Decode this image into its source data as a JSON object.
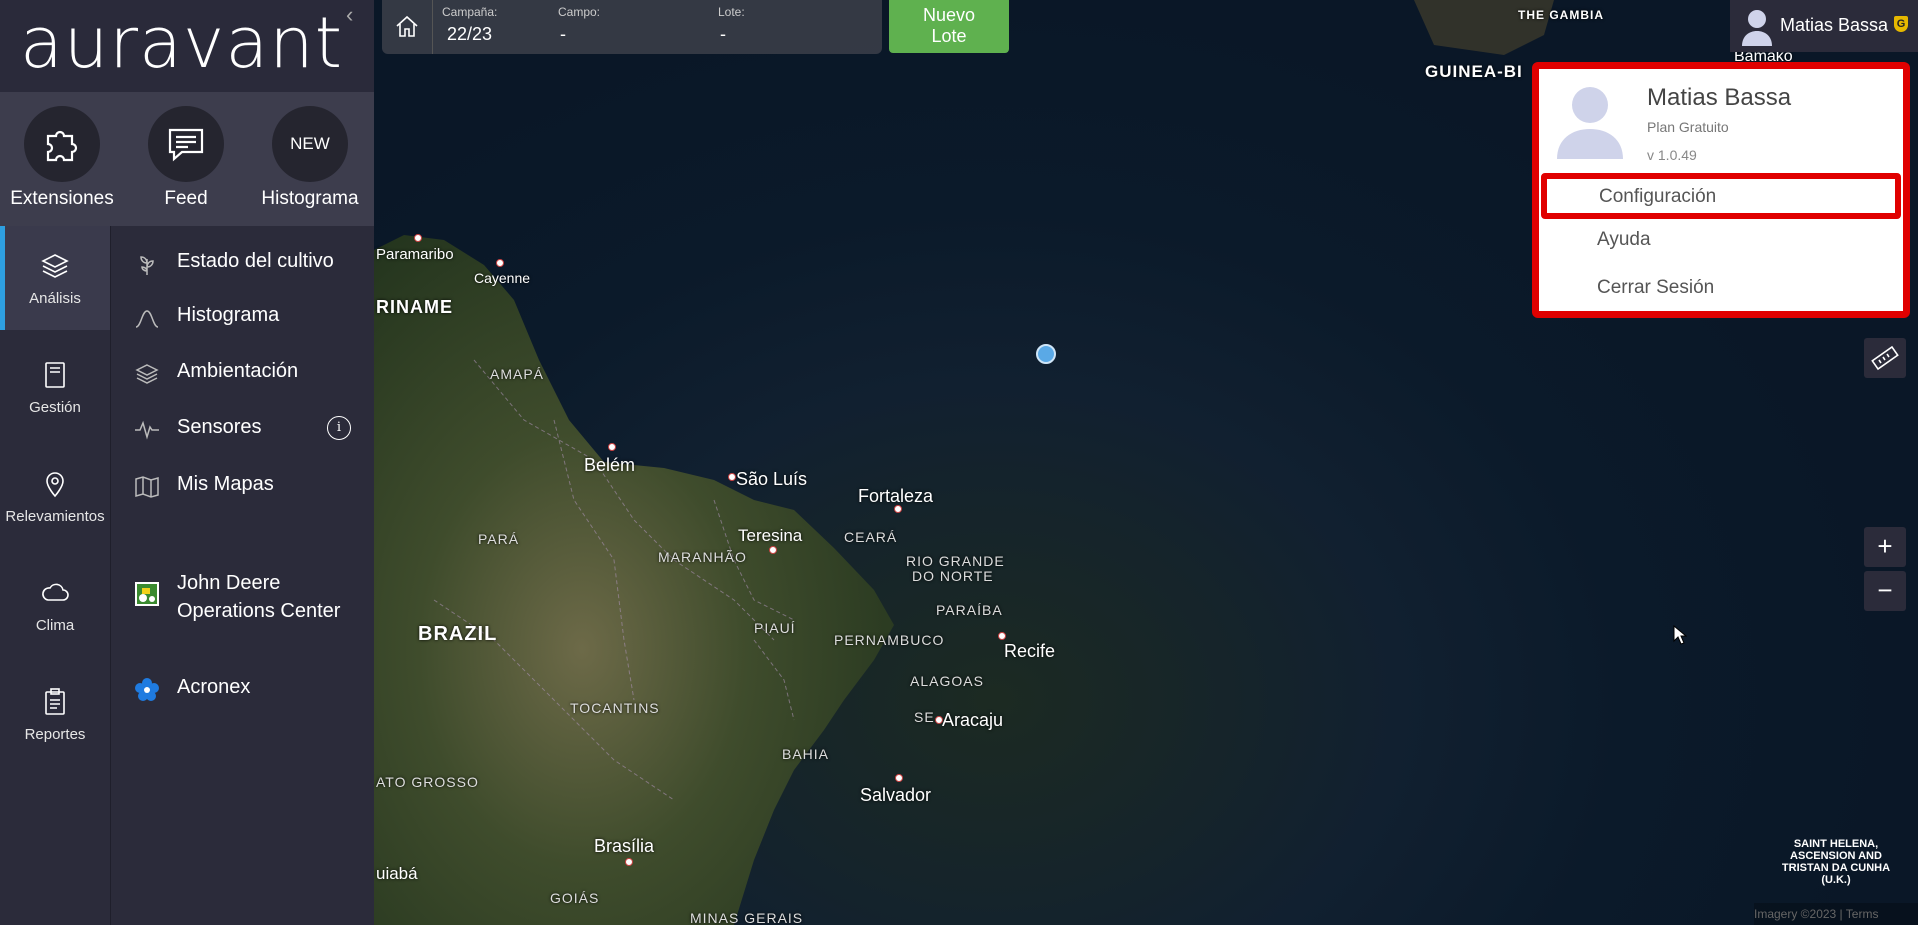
{
  "brand": {
    "logo": "auravant",
    "collapse_icon": "chevron-left-icon"
  },
  "quick_actions": [
    {
      "label": "Extensiones",
      "icon": "puzzle-icon"
    },
    {
      "label": "Feed",
      "icon": "chat-icon"
    },
    {
      "label": "Histograma",
      "badge": "NEW"
    }
  ],
  "rail": [
    {
      "label": "Análisis",
      "icon": "layers-icon",
      "active": true
    },
    {
      "label": "Gestión",
      "icon": "notebook-icon"
    },
    {
      "label": "Relevamientos",
      "icon": "map-pin-icon"
    },
    {
      "label": "Clima",
      "icon": "cloud-icon"
    },
    {
      "label": "Reportes",
      "icon": "clipboard-icon"
    }
  ],
  "menu": [
    {
      "label": "Estado del cultivo",
      "icon": "plant-icon"
    },
    {
      "label": "Histograma",
      "icon": "curve-icon"
    },
    {
      "label": "Ambientación",
      "icon": "layers-icon"
    },
    {
      "label": "Sensores",
      "icon": "signal-icon",
      "info": "i"
    },
    {
      "label": "Mis Mapas",
      "icon": "folded-map-icon"
    },
    {
      "label": "John Deere",
      "label2": "Operations Center",
      "icon": "tractor-icon"
    },
    {
      "label": "Acronex",
      "icon": "flower-icon"
    }
  ],
  "topbar": {
    "campana_label": "Campaña:",
    "campana_value": "22/23",
    "campo_label": "Campo:",
    "campo_value": "-",
    "lote_label": "Lote:",
    "lote_value": "-",
    "nuevo_line1": "Nuevo",
    "nuevo_line2": "Lote"
  },
  "user": {
    "name": "Matias Bassa",
    "badge": "G",
    "plan": "Plan Gratuito",
    "version": "v 1.0.49",
    "menu": {
      "config": "Configuración",
      "help": "Ayuda",
      "logout": "Cerrar Sesión"
    }
  },
  "map": {
    "labels": {
      "gambia": "THE GAMBIA",
      "guinea": "GUINEA-BI",
      "bamako": "Bamako",
      "paramaribo": "Paramaribo",
      "cayenne": "Cayenne",
      "riname": "RINAME",
      "amapa": "AMAPÁ",
      "belem": "Belém",
      "sao_luis": "São Luís",
      "fortaleza": "Fortaleza",
      "para": "PARÁ",
      "maranhao": "MARANHÃO",
      "teresina": "Teresina",
      "ceara": "CEARÁ",
      "rio_grande": "RIO GRANDE",
      "do_norte": "DO NORTE",
      "paraiba": "PARAÍBA",
      "brazil": "BRAZIL",
      "piaui": "PIAUÍ",
      "pernambuco": "PERNAMBUCO",
      "recife": "Recife",
      "alagoas": "ALAGOAS",
      "tocantins": "TOCANTINS",
      "se": "SE",
      "aracaju": "Aracaju",
      "bahia": "BAHIA",
      "mato_grosso": "ATO GROSSO",
      "salvador": "Salvador",
      "brasilia": "Brasília",
      "cuiaba": "uiabá",
      "goias": "GOIÁS",
      "minas": "MINAS GERAIS"
    },
    "st_helena": "SAINT HELENA, ASCENSION AND TRISTAN DA CUNHA (U.K.)",
    "attribution": "Imagery ©2023 | Terms",
    "zoom_in": "+",
    "zoom_out": "−",
    "ruler_icon": "ruler-icon"
  }
}
